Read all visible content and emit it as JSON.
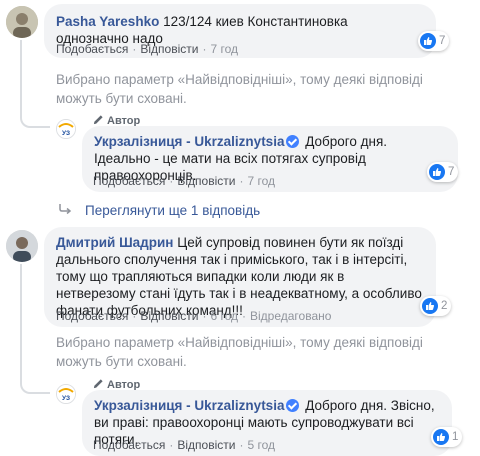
{
  "colors": {
    "link": "#385898",
    "like_blue": "#1877f2",
    "bubble_bg": "#f2f3f5",
    "muted": "#90949c"
  },
  "actions": {
    "like": "Подобається",
    "reply": "Відповісти",
    "edited": "Відредаговано"
  },
  "author_label": "Автор",
  "notice_text": "Вибрано параметр «Найвідповідніші», тому деякі відповіді можуть бути сховані.",
  "comments": [
    {
      "author": "Pasha Yareshko",
      "text": "123/124 киев Константиновка однозначно надо",
      "time": "7 год",
      "reactions": "7",
      "avatar_icon": "user-photo"
    },
    {
      "author": "Дмитрий Шадрин",
      "text": "Цей супровід повинен бути як поїзді дальнього сполучення так і приміського, так і в інтерсіті, тому що трапляються випадки коли люди як в нетверезому стані їдуть так і в неадекватному, а особливо фанати футбольних команд!!!",
      "time": "6 год",
      "reactions": "2",
      "avatar_icon": "user-photo"
    }
  ],
  "replies": [
    {
      "author": "Укрзалізниця - Ukrzaliznytsia",
      "text": "Доброго дня. Ідеально - це мати на всіх потягах супровід правоохоронців.",
      "time": "7 год",
      "reactions": "7",
      "avatar_icon": "uz-logo"
    },
    {
      "author": "Укрзалізниця - Ukrzaliznytsia",
      "text": "Доброго дня. Звісно, ви праві: правоохоронці мають супроводжувати всі потяги.",
      "time": "5 год",
      "reactions": "1",
      "avatar_icon": "uz-logo"
    }
  ],
  "view_more": "Переглянути ще 1 відповідь"
}
